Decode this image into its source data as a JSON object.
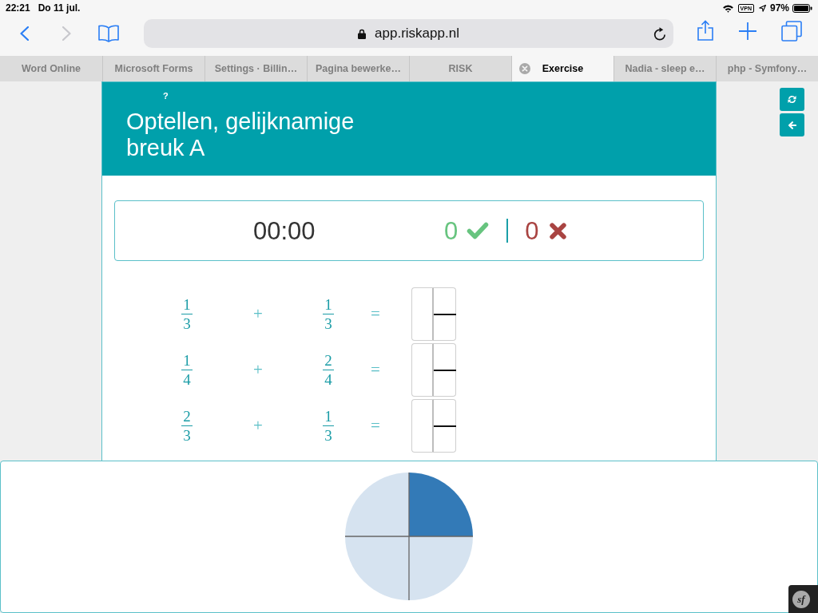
{
  "status_bar": {
    "time": "22:21",
    "date": "Do 11 jul.",
    "vpn": "VPN",
    "battery": "97%"
  },
  "toolbar": {
    "back": {
      "disabled": false
    },
    "forward": {
      "disabled": true
    },
    "address": "app.riskapp.nl"
  },
  "tabs": [
    {
      "label": "Word Online",
      "selected": false
    },
    {
      "label": "Microsoft Forms",
      "selected": false
    },
    {
      "label": "Settings · Billin…",
      "selected": false
    },
    {
      "label": "Pagina bewerke…",
      "selected": false
    },
    {
      "label": "RISK",
      "selected": false
    },
    {
      "label": "Exercise",
      "selected": true
    },
    {
      "label": "Nadia - sleep e…",
      "selected": false
    },
    {
      "label": "php - Symfony…",
      "selected": false
    }
  ],
  "side_buttons": [
    {
      "kind": "refresh"
    },
    {
      "kind": "back"
    }
  ],
  "exercise": {
    "help": "?",
    "title": "Optellen, gelijknamige breuk A",
    "score": {
      "time": "00:00",
      "correct": "0",
      "wrong": "0"
    },
    "problems": [
      {
        "left": {
          "numerator": "1",
          "denominator": "3"
        },
        "operator": "+",
        "right": {
          "numerator": "1",
          "denominator": "3"
        },
        "equals": "="
      },
      {
        "left": {
          "numerator": "1",
          "denominator": "4"
        },
        "operator": "+",
        "right": {
          "numerator": "2",
          "denominator": "4"
        },
        "equals": "="
      },
      {
        "left": {
          "numerator": "2",
          "denominator": "3"
        },
        "operator": "+",
        "right": {
          "numerator": "1",
          "denominator": "3"
        },
        "equals": "="
      }
    ]
  },
  "fraction_pie": {
    "slices": [
      {
        "filled": true
      },
      {
        "filled": false
      },
      {
        "filled": false
      },
      {
        "filled": false
      }
    ]
  },
  "debug_toolbar": {
    "label": "sf"
  }
}
